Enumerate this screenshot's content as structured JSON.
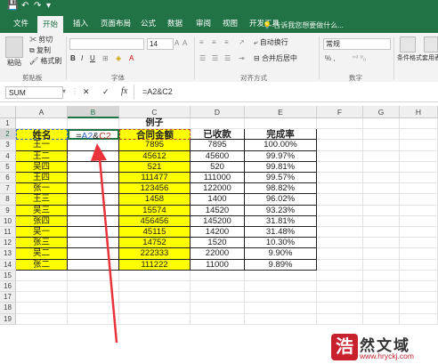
{
  "quick_access": [
    "💾",
    "↶",
    "↷",
    "▾"
  ],
  "menu": {
    "tabs": [
      "文件",
      "开始",
      "插入",
      "页面布局",
      "公式",
      "数据",
      "审阅",
      "视图",
      "开发工具"
    ],
    "active": "开始",
    "tell_me": "告诉我您想要做什么..."
  },
  "ribbon": {
    "paste": "粘贴",
    "cut": "剪切",
    "copy": "复制",
    "format_painter": "格式刷",
    "clipboard": "剪贴板",
    "font": "字体",
    "font_size": "14",
    "bold": "B",
    "italic": "I",
    "underline": "U",
    "wrap": "自动换行",
    "merge": "合并后居中",
    "align": "对齐方式",
    "number_format": "常规",
    "percent": "% ,",
    "number": "数字",
    "cond": "条件格式",
    "table_fmt": "套用表格格式"
  },
  "formula_bar": {
    "name_box": "SUM",
    "cancel": "✕",
    "enter": "✓",
    "fx": "fx",
    "content": "=A2&C2"
  },
  "grid": {
    "columns": [
      "A",
      "B",
      "C",
      "D",
      "E",
      "F",
      "G",
      "H"
    ],
    "rows": [
      "1",
      "2",
      "3",
      "4",
      "5",
      "6",
      "7",
      "8",
      "9",
      "10",
      "11",
      "12",
      "13",
      "14",
      "15",
      "16",
      "17",
      "18",
      "19"
    ],
    "title": "例子",
    "headers": [
      "姓名",
      "=A2&C2",
      "合同金额",
      "已收款",
      "完成率"
    ],
    "data": [
      [
        "王一",
        "7895",
        "7895",
        "100.00%"
      ],
      [
        "王二",
        "45612",
        "45600",
        "99.97%"
      ],
      [
        "吴四",
        "521",
        "520",
        "99.81%"
      ],
      [
        "王四",
        "111477",
        "111000",
        "99.57%"
      ],
      [
        "张一",
        "123456",
        "122000",
        "98.82%"
      ],
      [
        "王三",
        "1458",
        "1400",
        "96.02%"
      ],
      [
        "吴三",
        "15574",
        "14520",
        "93.23%"
      ],
      [
        "张四",
        "456456",
        "145200",
        "31.81%"
      ],
      [
        "吴一",
        "45115",
        "14200",
        "31.48%"
      ],
      [
        "张三",
        "14752",
        "1520",
        "10.30%"
      ],
      [
        "吴二",
        "222333",
        "22000",
        "9.90%"
      ],
      [
        "张二",
        "111222",
        "11000",
        "9.89%"
      ]
    ]
  },
  "watermark": {
    "glyph": "浩",
    "brand": "然文域",
    "url": "www.hryckj.com"
  },
  "colors": {
    "excel_green": "#217346",
    "highlight": "#ffff00",
    "arrow": "#e8333a",
    "ref_blue": "#2e67c9",
    "ref_red": "#c0392b"
  }
}
